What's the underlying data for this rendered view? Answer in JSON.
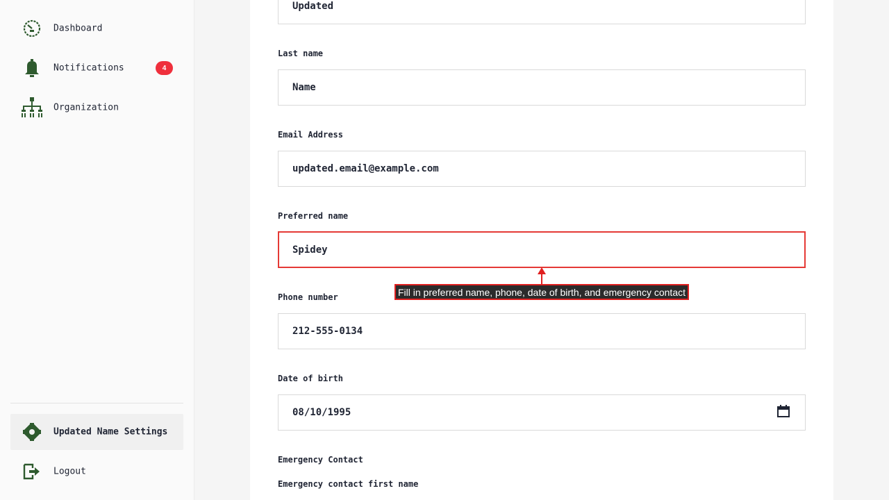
{
  "sidebar": {
    "items": [
      {
        "label": "Dashboard",
        "icon": "dashboard-icon"
      },
      {
        "label": "Notifications",
        "icon": "bell-icon",
        "badge": "4"
      },
      {
        "label": "Organization",
        "icon": "org-chart-icon"
      }
    ],
    "bottom": [
      {
        "label": "Updated Name Settings",
        "icon": "gear-icon",
        "active": true
      },
      {
        "label": "Logout",
        "icon": "logout-icon"
      }
    ]
  },
  "form": {
    "first_name_value": "Updated",
    "last_name_label": "Last name",
    "last_name_value": "Name",
    "email_label": "Email Address",
    "email_value": "updated.email@example.com",
    "preferred_name_label": "Preferred name",
    "preferred_name_value": "Spidey",
    "phone_label": "Phone number",
    "phone_value": "212-555-0134",
    "dob_label": "Date of birth",
    "dob_value": "08/10/1995",
    "emergency_section": "Emergency Contact",
    "emergency_first_name_label": "Emergency contact first name"
  },
  "tooltip": {
    "text": "Fill in preferred name, phone, date of birth, and emergency contact"
  },
  "colors": {
    "icon_green": "#2e5a2e",
    "badge_red": "#ef2f3c",
    "highlight_red": "#e53935"
  }
}
